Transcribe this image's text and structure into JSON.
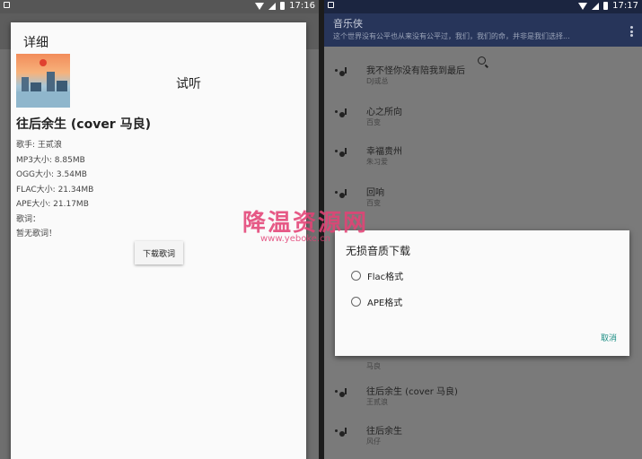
{
  "left_status": {
    "time": "17:16"
  },
  "detail": {
    "title": "详细",
    "preview_label": "试听",
    "song_title": "往后余生 (cover 马良)",
    "singer": "歌手: 王贰浪",
    "mp3_size": "MP3大小: 8.85MB",
    "ogg_size": "OGG大小: 3.54MB",
    "flac_size": "FLAC大小: 21.34MB",
    "ape_size": "APE大小: 21.17MB",
    "lyrics_label": "歌词：",
    "no_lyrics": "暂无歌词！",
    "download_lyrics_label": "下载歌词"
  },
  "right_status": {
    "time": "17:17"
  },
  "app": {
    "title": "音乐侠",
    "subtitle": "这个世界没有公平也从来没有公平过，我们，我们的命，并非是我们选择..."
  },
  "songs_top": [
    {
      "name": "我不怪你没有陪我到最后",
      "artist": "DJ或总"
    },
    {
      "name": "心之所向",
      "artist": "百变"
    },
    {
      "name": "幸福贵州",
      "artist": "朱习爱"
    },
    {
      "name": "回响",
      "artist": "百变"
    }
  ],
  "songs_bottom": [
    {
      "artist": "马良"
    },
    {
      "name": "往后余生 (cover 马良)",
      "artist": "王贰浪"
    },
    {
      "name": "往后余生",
      "artist": "风仔"
    }
  ],
  "lossless_dialog": {
    "title": "无损音质下载",
    "option_flac": "Flac格式",
    "option_ape": "APE格式",
    "cancel_label": "取消"
  },
  "watermark": {
    "text": "降温资源网",
    "url": "www.yeboke.cn"
  }
}
